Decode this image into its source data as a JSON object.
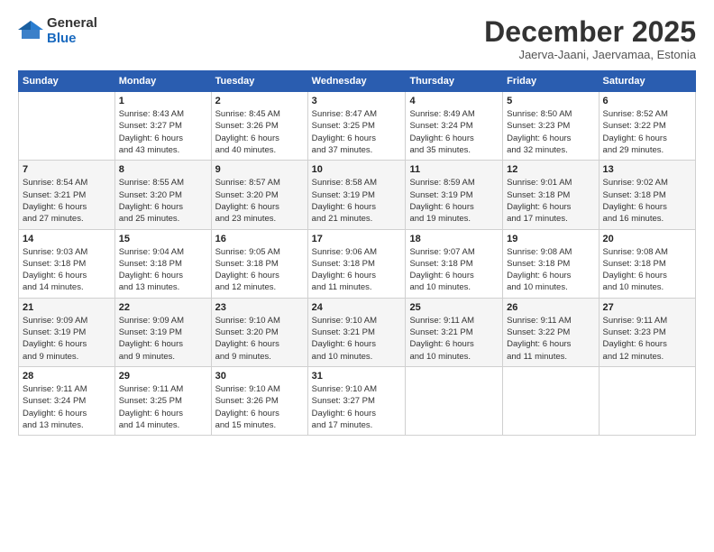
{
  "logo": {
    "general": "General",
    "blue": "Blue"
  },
  "header": {
    "month": "December 2025",
    "location": "Jaerva-Jaani, Jaervamaa, Estonia"
  },
  "weekdays": [
    "Sunday",
    "Monday",
    "Tuesday",
    "Wednesday",
    "Thursday",
    "Friday",
    "Saturday"
  ],
  "weeks": [
    [
      {
        "day": "",
        "detail": ""
      },
      {
        "day": "1",
        "detail": "Sunrise: 8:43 AM\nSunset: 3:27 PM\nDaylight: 6 hours\nand 43 minutes."
      },
      {
        "day": "2",
        "detail": "Sunrise: 8:45 AM\nSunset: 3:26 PM\nDaylight: 6 hours\nand 40 minutes."
      },
      {
        "day": "3",
        "detail": "Sunrise: 8:47 AM\nSunset: 3:25 PM\nDaylight: 6 hours\nand 37 minutes."
      },
      {
        "day": "4",
        "detail": "Sunrise: 8:49 AM\nSunset: 3:24 PM\nDaylight: 6 hours\nand 35 minutes."
      },
      {
        "day": "5",
        "detail": "Sunrise: 8:50 AM\nSunset: 3:23 PM\nDaylight: 6 hours\nand 32 minutes."
      },
      {
        "day": "6",
        "detail": "Sunrise: 8:52 AM\nSunset: 3:22 PM\nDaylight: 6 hours\nand 29 minutes."
      }
    ],
    [
      {
        "day": "7",
        "detail": "Sunrise: 8:54 AM\nSunset: 3:21 PM\nDaylight: 6 hours\nand 27 minutes."
      },
      {
        "day": "8",
        "detail": "Sunrise: 8:55 AM\nSunset: 3:20 PM\nDaylight: 6 hours\nand 25 minutes."
      },
      {
        "day": "9",
        "detail": "Sunrise: 8:57 AM\nSunset: 3:20 PM\nDaylight: 6 hours\nand 23 minutes."
      },
      {
        "day": "10",
        "detail": "Sunrise: 8:58 AM\nSunset: 3:19 PM\nDaylight: 6 hours\nand 21 minutes."
      },
      {
        "day": "11",
        "detail": "Sunrise: 8:59 AM\nSunset: 3:19 PM\nDaylight: 6 hours\nand 19 minutes."
      },
      {
        "day": "12",
        "detail": "Sunrise: 9:01 AM\nSunset: 3:18 PM\nDaylight: 6 hours\nand 17 minutes."
      },
      {
        "day": "13",
        "detail": "Sunrise: 9:02 AM\nSunset: 3:18 PM\nDaylight: 6 hours\nand 16 minutes."
      }
    ],
    [
      {
        "day": "14",
        "detail": "Sunrise: 9:03 AM\nSunset: 3:18 PM\nDaylight: 6 hours\nand 14 minutes."
      },
      {
        "day": "15",
        "detail": "Sunrise: 9:04 AM\nSunset: 3:18 PM\nDaylight: 6 hours\nand 13 minutes."
      },
      {
        "day": "16",
        "detail": "Sunrise: 9:05 AM\nSunset: 3:18 PM\nDaylight: 6 hours\nand 12 minutes."
      },
      {
        "day": "17",
        "detail": "Sunrise: 9:06 AM\nSunset: 3:18 PM\nDaylight: 6 hours\nand 11 minutes."
      },
      {
        "day": "18",
        "detail": "Sunrise: 9:07 AM\nSunset: 3:18 PM\nDaylight: 6 hours\nand 10 minutes."
      },
      {
        "day": "19",
        "detail": "Sunrise: 9:08 AM\nSunset: 3:18 PM\nDaylight: 6 hours\nand 10 minutes."
      },
      {
        "day": "20",
        "detail": "Sunrise: 9:08 AM\nSunset: 3:18 PM\nDaylight: 6 hours\nand 10 minutes."
      }
    ],
    [
      {
        "day": "21",
        "detail": "Sunrise: 9:09 AM\nSunset: 3:19 PM\nDaylight: 6 hours\nand 9 minutes."
      },
      {
        "day": "22",
        "detail": "Sunrise: 9:09 AM\nSunset: 3:19 PM\nDaylight: 6 hours\nand 9 minutes."
      },
      {
        "day": "23",
        "detail": "Sunrise: 9:10 AM\nSunset: 3:20 PM\nDaylight: 6 hours\nand 9 minutes."
      },
      {
        "day": "24",
        "detail": "Sunrise: 9:10 AM\nSunset: 3:21 PM\nDaylight: 6 hours\nand 10 minutes."
      },
      {
        "day": "25",
        "detail": "Sunrise: 9:11 AM\nSunset: 3:21 PM\nDaylight: 6 hours\nand 10 minutes."
      },
      {
        "day": "26",
        "detail": "Sunrise: 9:11 AM\nSunset: 3:22 PM\nDaylight: 6 hours\nand 11 minutes."
      },
      {
        "day": "27",
        "detail": "Sunrise: 9:11 AM\nSunset: 3:23 PM\nDaylight: 6 hours\nand 12 minutes."
      }
    ],
    [
      {
        "day": "28",
        "detail": "Sunrise: 9:11 AM\nSunset: 3:24 PM\nDaylight: 6 hours\nand 13 minutes."
      },
      {
        "day": "29",
        "detail": "Sunrise: 9:11 AM\nSunset: 3:25 PM\nDaylight: 6 hours\nand 14 minutes."
      },
      {
        "day": "30",
        "detail": "Sunrise: 9:10 AM\nSunset: 3:26 PM\nDaylight: 6 hours\nand 15 minutes."
      },
      {
        "day": "31",
        "detail": "Sunrise: 9:10 AM\nSunset: 3:27 PM\nDaylight: 6 hours\nand 17 minutes."
      },
      {
        "day": "",
        "detail": ""
      },
      {
        "day": "",
        "detail": ""
      },
      {
        "day": "",
        "detail": ""
      }
    ]
  ]
}
